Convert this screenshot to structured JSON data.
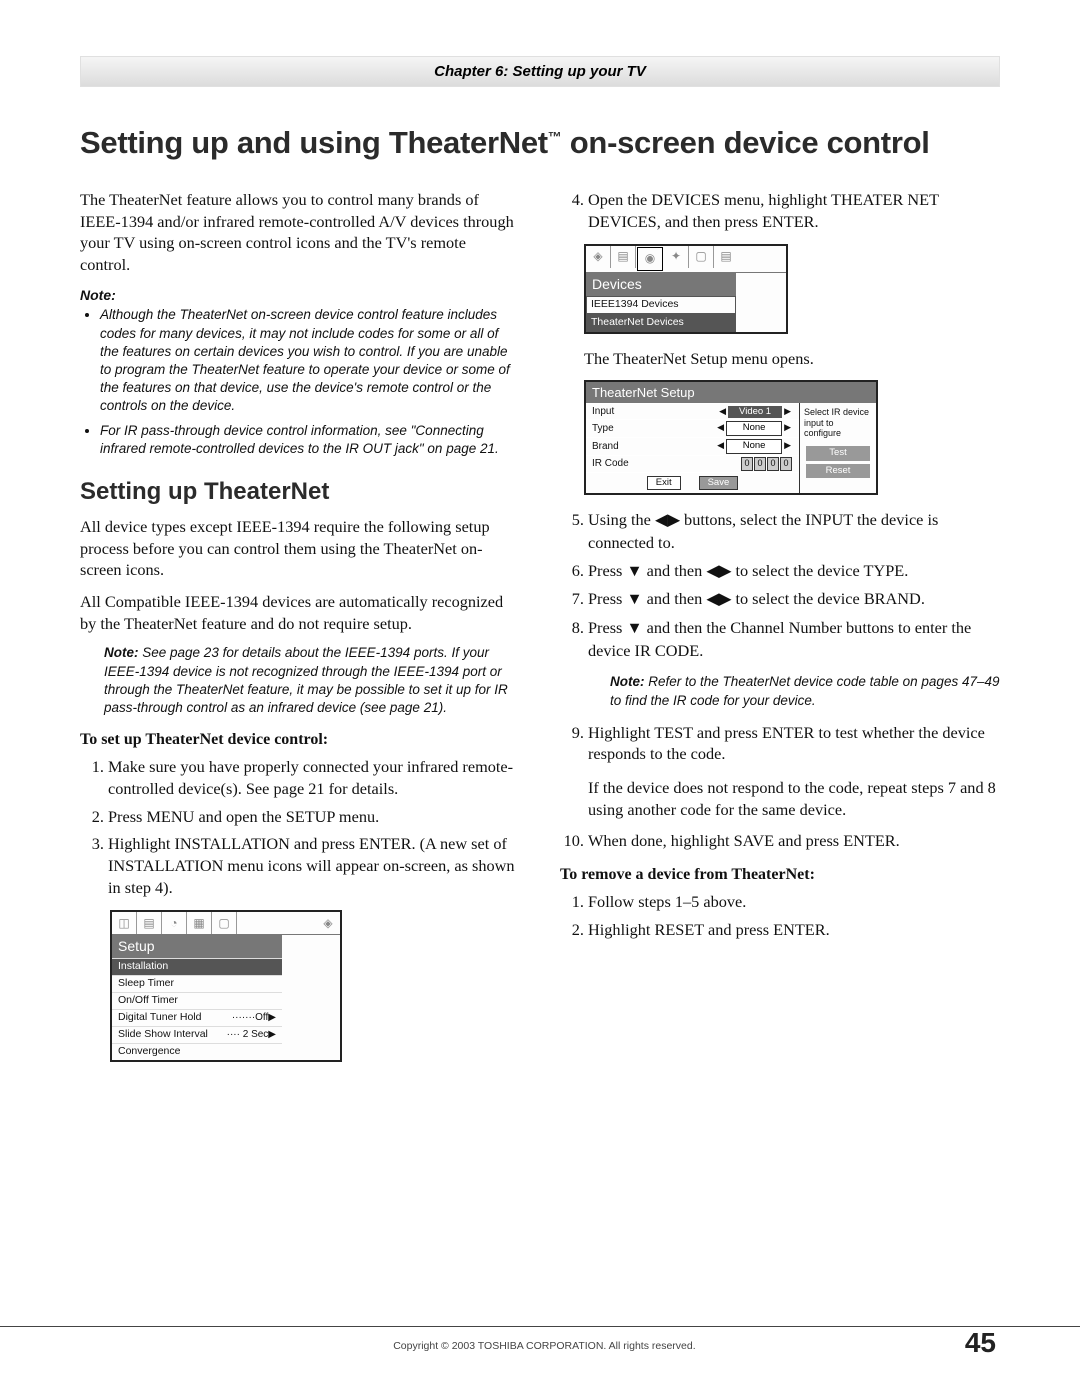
{
  "chapter": "Chapter 6: Setting up your TV",
  "title_prefix": "Setting up and using TheaterNet",
  "title_suffix": " on-screen device control",
  "tm": "™",
  "intro": "The TheaterNet feature allows you to control many brands of IEEE-1394 and/or infrared remote-controlled A/V devices through your TV using on-screen control icons and the TV's remote control.",
  "note_label": "Note:",
  "note_bul": [
    "Although the TheaterNet on-screen device control feature includes codes for many devices, it may not include codes for some or all of the features on certain devices you wish to control. If you are unable to program the TheaterNet feature to operate your device or some of the features on that device, use the device's remote control or the controls on the device.",
    "For IR pass-through device control information, see \"Connecting infrared remote-controlled devices to the IR OUT jack\" on page 21."
  ],
  "section1": "Setting up TheaterNet",
  "s1p1": "All device types except IEEE-1394 require the following setup process before you can control them using the TheaterNet on-screen icons.",
  "s1p2": "All Compatible IEEE-1394 devices are automatically recognized by the TheaterNet feature and do not require setup.",
  "s1note_b": "Note:",
  "s1note": " See page 23 for details about the IEEE-1394 ports. If your IEEE-1394 device is not recognized through the IEEE-1394 port or through the TheaterNet feature, it may be possible to set it up for IR pass-through control as an infrared device (see page 21).",
  "to_setup": "To set up TheaterNet device control:",
  "steps_a": [
    "Make sure you have properly connected your infrared remote-controlled device(s). See page 21 for details.",
    "Press MENU and open the SETUP menu.",
    "Highlight INSTALLATION and press ENTER. (A new set of INSTALLATION menu icons will appear on-screen, as shown in step 4)."
  ],
  "setup_menu": {
    "title": "Setup",
    "items": [
      {
        "l": "Installation",
        "sel": true
      },
      {
        "l": "Sleep Timer"
      },
      {
        "l": "On/Off Timer"
      },
      {
        "l": "Digital Tuner Hold",
        "r": "·······Off▶"
      },
      {
        "l": "Slide Show Interval",
        "r": "···· 2 Sec▶"
      },
      {
        "l": "Convergence"
      }
    ]
  },
  "step4": "Open the DEVICES menu, highlight THEATER NET DEVICES, and then press ENTER.",
  "devices_menu": {
    "title": "Devices",
    "items": [
      {
        "l": "IEEE1394 Devices"
      },
      {
        "l": "TheaterNet Devices",
        "sel": true
      }
    ]
  },
  "tn_opens": "The TheaterNet Setup menu opens.",
  "tn_menu": {
    "title": "TheaterNet Setup",
    "rows": [
      {
        "l": "Input",
        "v": "Video 1",
        "dark": true
      },
      {
        "l": "Type",
        "v": "None"
      },
      {
        "l": "Brand",
        "v": "None"
      },
      {
        "l": "IR Code",
        "ir": "0000"
      }
    ],
    "hint": "Select IR device input to configure",
    "test": "Test",
    "reset": "Reset",
    "exit": "Exit",
    "save": "Save"
  },
  "step5a": "Using the ",
  "step5b": " buttons, select the INPUT the device is connected to.",
  "step6a": "Press ",
  "step6b": " and then ",
  "step6c": " to select the device TYPE.",
  "step7a": "Press ",
  "step7b": " and then ",
  "step7c": " to select the device BRAND.",
  "step8a": "Press ",
  "step8b": " and then the Channel Number buttons to enter the device IR CODE.",
  "step8_note_b": "Note:",
  "step8_note": " Refer to the TheaterNet device code table on pages 47–49 to find the IR code for your device.",
  "step9": "Highlight TEST and press ENTER to test whether the device responds to the code.",
  "step9f": "If the device does not respond to the code, repeat steps 7 and 8 using another code for the same device.",
  "step10": "When done, highlight SAVE and press ENTER.",
  "to_remove": "To remove a device from TheaterNet:",
  "rm1": "Follow steps 1–5 above.",
  "rm2": "Highlight RESET and press ENTER.",
  "copyright": "Copyright © 2003 TOSHIBA CORPORATION. All rights reserved.",
  "page_no": "45",
  "arrows": {
    "lr": "◀▶",
    "down": "▼"
  }
}
